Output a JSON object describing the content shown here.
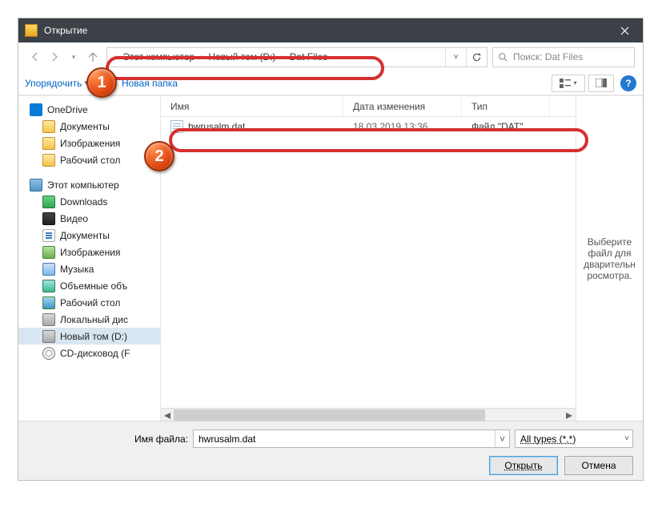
{
  "title": "Открытие",
  "breadcrumb": [
    "Этот компьютер",
    "Новый том (D:)",
    "Dat Files"
  ],
  "search_placeholder": "Поиск: Dat Files",
  "toolbar": {
    "organize": "Упорядочить",
    "new_folder": "Новая папка"
  },
  "tree": {
    "onedrive": "OneDrive",
    "od_docs": "Документы",
    "od_pics": "Изображения",
    "od_desktop": "Рабочий стол",
    "this_pc": "Этот компьютер",
    "downloads": "Downloads",
    "videos": "Видео",
    "docs": "Документы",
    "pics": "Изображения",
    "music": "Музыка",
    "objects3d": "Объемные объ",
    "desktop": "Рабочий стол",
    "local_disk": "Локальный дис",
    "new_volume": "Новый том (D:)",
    "cd_drive": "CD-дисковод (F"
  },
  "columns": {
    "name": "Имя",
    "date": "Дата изменения",
    "type": "Тип"
  },
  "files": [
    {
      "name": "hwrusalm.dat",
      "date": "18.03.2019 13:36",
      "type": "Файл \"DAT\""
    }
  ],
  "preview_text": "Выберите файл для дварительн росмотра.",
  "filename_label": "Имя файла:",
  "filename_value": "hwrusalm.dat",
  "filter": "All types (*.*)",
  "buttons": {
    "open": "Открыть",
    "cancel": "Отмена"
  }
}
